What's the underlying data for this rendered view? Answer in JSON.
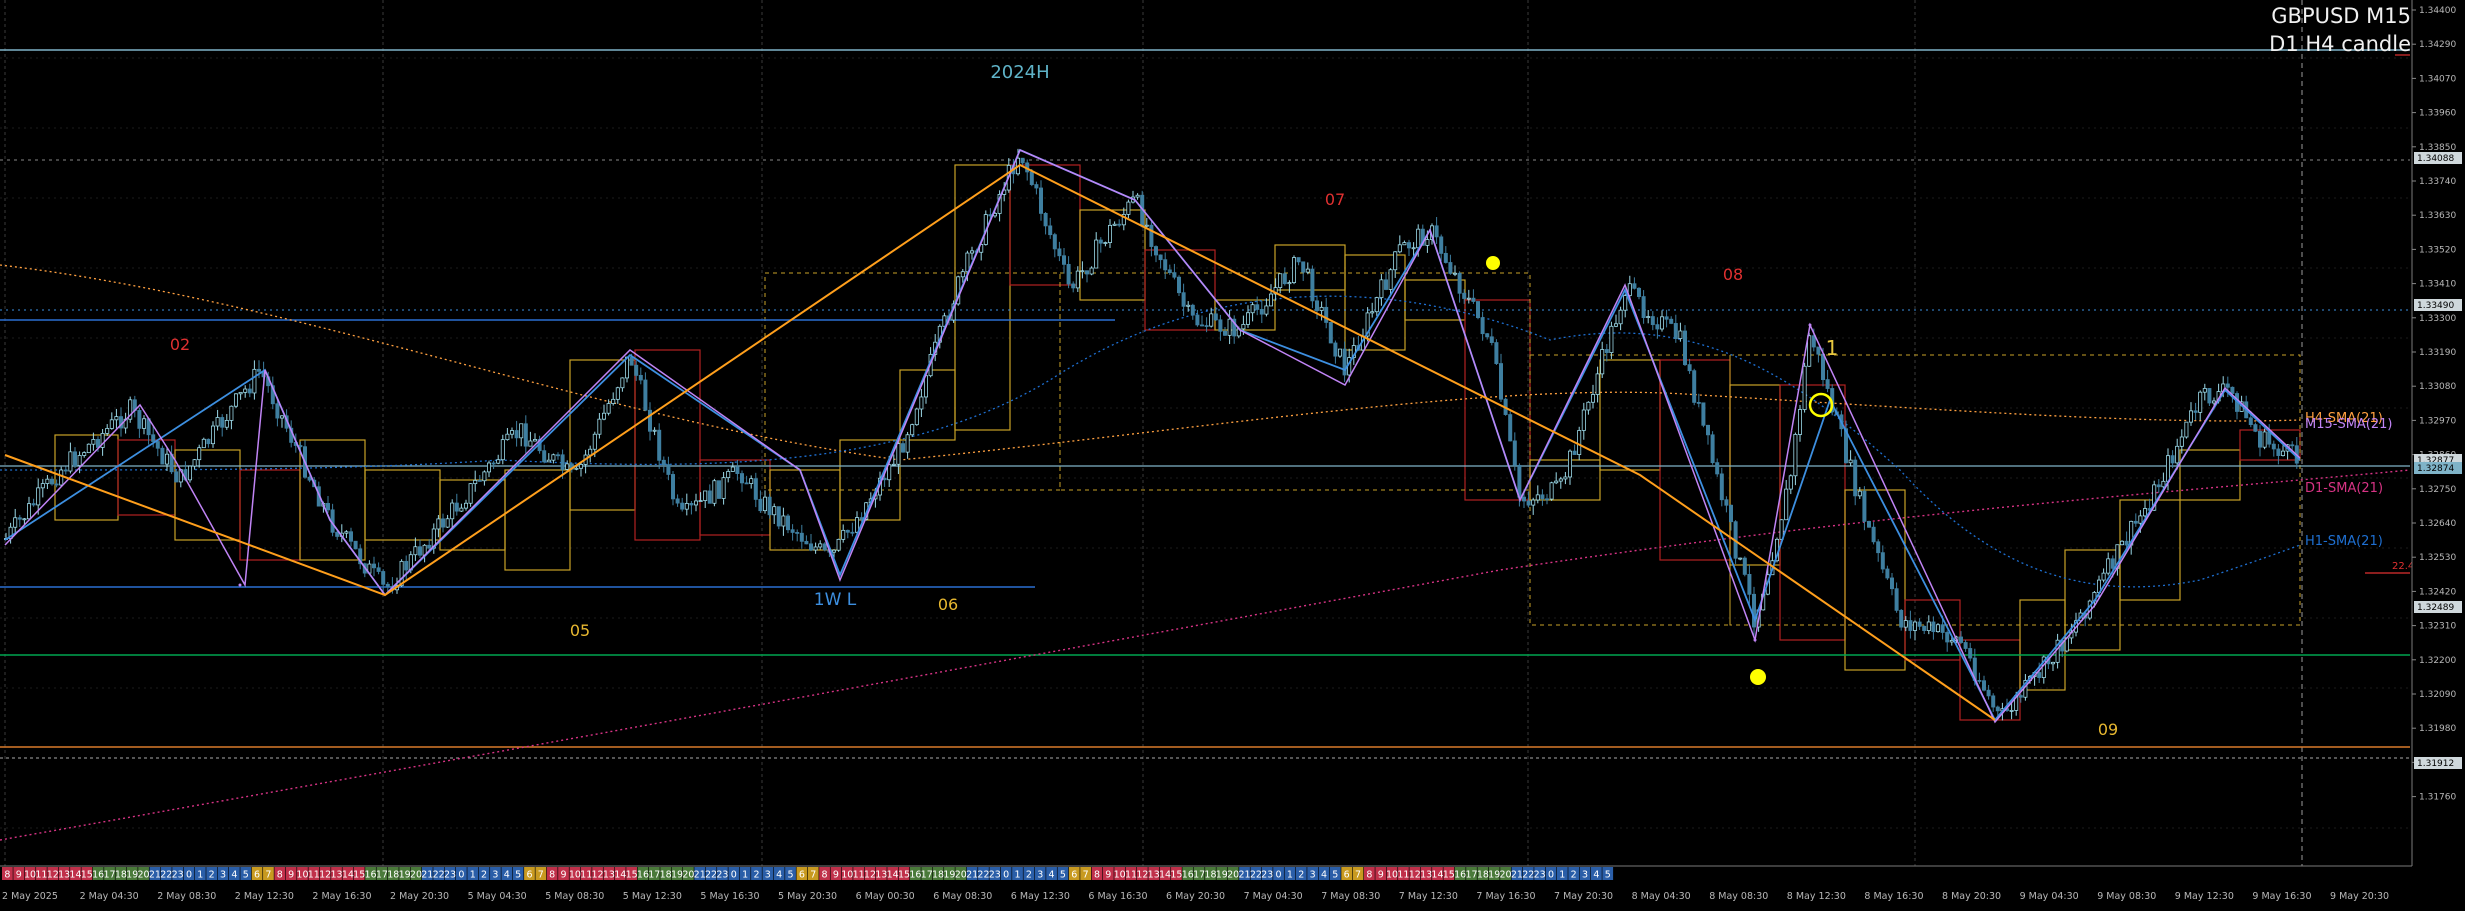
{
  "header": {
    "symbol_timeframe": "GBPUSD M15",
    "indicator_label": "D1 H4 candle"
  },
  "colors": {
    "background": "#000000",
    "grid": "#3a3a3a",
    "bull_candle": "#9bd9e8",
    "bear_candle": "#3f7fa0",
    "zigzag_blue": "#3d8fe0",
    "zigzag_violet": "#c084f5",
    "trend_orange": "#ff9f1c",
    "h4_box_yellow": "#c9a227",
    "h4_box_red": "#b22222",
    "sma_h1": "#1e6fd1",
    "sma_h4": "#ffa040",
    "sma_d1": "#d63384",
    "support_green": "#00a550",
    "level_cyan": "#7fb3c8",
    "annotation_red": "#e03030",
    "annotation_yellow": "#e8c840",
    "marker_yellow": "#ffff00"
  },
  "price_axis": {
    "labels": [
      "1.34400",
      "1.34290",
      "1.34070",
      "1.33960",
      "1.33850",
      "1.33740",
      "1.33630",
      "1.33520",
      "1.33410",
      "1.33300",
      "1.33190",
      "1.33080",
      "1.32970",
      "1.32860",
      "1.32750",
      "1.32640",
      "1.32530",
      "1.32420",
      "1.32310",
      "1.32200",
      "1.32090",
      "1.31980",
      "1.31870",
      "1.31760"
    ],
    "highlighted": [
      {
        "label": "1.34088",
        "color": "#cfd8dc"
      },
      {
        "label": "1.33490",
        "color": "#cfd8dc"
      },
      {
        "label": "1.32877",
        "color": "#cfd8dc"
      },
      {
        "label": "1.32874",
        "color": "#7fb3c8"
      },
      {
        "label": "1.32489",
        "color": "#cfd8dc"
      },
      {
        "label": "1.31912",
        "color": "#cfd8dc"
      }
    ],
    "range": [
      1.3166,
      1.3448
    ]
  },
  "time_axis": {
    "labels": [
      "2 May 2025",
      "2 May 04:30",
      "2 May 08:30",
      "2 May 12:30",
      "2 May 16:30",
      "2 May 20:30",
      "5 May 04:30",
      "5 May 08:30",
      "5 May 12:30",
      "5 May 16:30",
      "5 May 20:30",
      "6 May 00:30",
      "6 May 08:30",
      "6 May 12:30",
      "6 May 16:30",
      "6 May 20:30",
      "7 May 04:30",
      "7 May 08:30",
      "7 May 12:30",
      "7 May 16:30",
      "7 May 20:30",
      "8 May 04:30",
      "8 May 08:30",
      "8 May 12:30",
      "8 May 16:30",
      "8 May 20:30",
      "9 May 04:30",
      "9 May 08:30",
      "9 May 12:30",
      "9 May 16:30",
      "9 May 20:30"
    ]
  },
  "hour_strip": [
    {
      "hours": [
        "8",
        "9",
        "10",
        "11",
        "12",
        "13",
        "14",
        "15"
      ],
      "color": "#c0304a"
    },
    {
      "hours": [
        "16",
        "17",
        "18",
        "19",
        "20"
      ],
      "color": "#4a7a3a"
    },
    {
      "hours": [
        "21",
        "22",
        "23",
        "0",
        "1",
        "2",
        "3",
        "4",
        "5"
      ],
      "color": "#2a5ea8"
    },
    {
      "hours": [
        "6",
        "7"
      ],
      "color": "#c89a20"
    },
    {
      "hours": [
        "8",
        "9",
        "10",
        "11",
        "12",
        "13",
        "14",
        "15"
      ],
      "color": "#c0304a"
    },
    {
      "hours": [
        "16",
        "17",
        "18",
        "19",
        "20"
      ],
      "color": "#4a7a3a"
    },
    {
      "hours": [
        "21",
        "22",
        "23",
        "0",
        "1",
        "2",
        "3",
        "4",
        "5"
      ],
      "color": "#2a5ea8"
    },
    {
      "hours": [
        "6",
        "7"
      ],
      "color": "#c89a20"
    },
    {
      "hours": [
        "8",
        "9",
        "10",
        "11",
        "12",
        "13",
        "14",
        "15"
      ],
      "color": "#c0304a"
    },
    {
      "hours": [
        "16",
        "17",
        "18",
        "19",
        "20"
      ],
      "color": "#4a7a3a"
    },
    {
      "hours": [
        "21",
        "22",
        "23",
        "0",
        "1",
        "2",
        "3",
        "4",
        "5"
      ],
      "color": "#2a5ea8"
    },
    {
      "hours": [
        "6",
        "7"
      ],
      "color": "#c89a20"
    },
    {
      "hours": [
        "8",
        "9",
        "10",
        "11",
        "12",
        "13",
        "14",
        "15"
      ],
      "color": "#c0304a"
    },
    {
      "hours": [
        "16",
        "17",
        "18",
        "19",
        "20"
      ],
      "color": "#4a7a3a"
    },
    {
      "hours": [
        "21",
        "22",
        "23",
        "0",
        "1",
        "2",
        "3",
        "4",
        "5"
      ],
      "color": "#2a5ea8"
    },
    {
      "hours": [
        "6",
        "7"
      ],
      "color": "#c89a20"
    },
    {
      "hours": [
        "8",
        "9",
        "10",
        "11",
        "12",
        "13",
        "14",
        "15"
      ],
      "color": "#c0304a"
    },
    {
      "hours": [
        "16",
        "17",
        "18",
        "19",
        "20"
      ],
      "color": "#4a7a3a"
    },
    {
      "hours": [
        "21",
        "22",
        "23",
        "0",
        "1",
        "2",
        "3",
        "4",
        "5"
      ],
      "color": "#2a5ea8"
    },
    {
      "hours": [
        "6",
        "7"
      ],
      "color": "#c89a20"
    },
    {
      "hours": [
        "8",
        "9",
        "10",
        "11",
        "12",
        "13",
        "14",
        "15"
      ],
      "color": "#c0304a"
    },
    {
      "hours": [
        "16",
        "17",
        "18",
        "19",
        "20"
      ],
      "color": "#4a7a3a"
    },
    {
      "hours": [
        "21",
        "22",
        "23",
        "0",
        "1",
        "2",
        "3",
        "4",
        "5"
      ],
      "color": "#2a5ea8"
    }
  ],
  "annotations": [
    {
      "text": "2024H",
      "color": "#5fb3c8"
    },
    {
      "text": "1W L",
      "color": "#3d8fe0"
    },
    {
      "text": "02",
      "color": "#e03030"
    },
    {
      "text": "05",
      "color": "#e8b830"
    },
    {
      "text": "06",
      "color": "#e8b830"
    },
    {
      "text": "07",
      "color": "#e03030"
    },
    {
      "text": "08",
      "color": "#e03030"
    },
    {
      "text": "09",
      "color": "#e8b830"
    },
    {
      "text": "1",
      "color": "#e8c840"
    }
  ],
  "sma_labels": [
    {
      "text": "H4-SMA(21)",
      "color": "#ffa040"
    },
    {
      "text": "M15-SMA(21)",
      "color": "#c084f5"
    },
    {
      "text": "D1-SMA(21)",
      "color": "#d63384"
    },
    {
      "text": "H1-SMA(21)",
      "color": "#1e6fd1"
    }
  ],
  "small_level_label": "22.4",
  "chart_data": {
    "type": "candlestick",
    "symbol": "GBPUSD",
    "timeframe": "M15",
    "ylim": [
      1.3166,
      1.3448
    ],
    "zigzag_points": [
      {
        "time": "2 May 2025",
        "price": 1.3268
      },
      {
        "time": "2 May 12:30",
        "price": 1.3325
      },
      {
        "time": "2 May 20:30",
        "price": 1.3238
      },
      {
        "time": "5 May 12:30",
        "price": 1.3334
      },
      {
        "time": "5 May 20:30",
        "price": 1.327
      },
      {
        "time": "6 May 00:30",
        "price": 1.3258
      },
      {
        "time": "6 May 12:30",
        "price": 1.3405
      },
      {
        "time": "6 May 16:30",
        "price": 1.336
      },
      {
        "time": "7 May 12:30",
        "price": 1.33
      },
      {
        "time": "7 May 16:30",
        "price": 1.338
      },
      {
        "time": "7 May 20:30",
        "price": 1.328
      },
      {
        "time": "8 May 04:30",
        "price": 1.3355
      },
      {
        "time": "8 May 08:30",
        "price": 1.3238
      },
      {
        "time": "8 May 12:30",
        "price": 1.335
      },
      {
        "time": "8 May 16:30",
        "price": 1.325
      },
      {
        "time": "9 May 04:30",
        "price": 1.3208
      },
      {
        "time": "9 May 16:30",
        "price": 1.3315
      },
      {
        "time": "9 May 20:30",
        "price": 1.329
      }
    ],
    "horizontal_levels": [
      {
        "name": "2024H",
        "price": 1.343
      },
      {
        "name": "1W L",
        "price": 1.3245
      },
      {
        "name": "support",
        "price": 1.3233
      },
      {
        "name": "level",
        "price": 1.3287
      }
    ]
  }
}
